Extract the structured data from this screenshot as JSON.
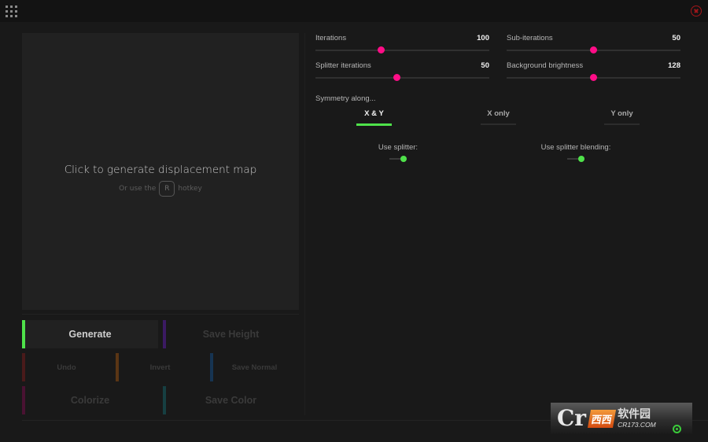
{
  "titlebar": {
    "menu_icon": "apps-grid-icon",
    "close_icon": "close-circle-icon",
    "close_color": "#a3161a"
  },
  "canvas": {
    "title": "Click to generate displacement map",
    "hint_prefix": "Or use the",
    "hotkey": "R",
    "hint_suffix": "hotkey"
  },
  "buttons": {
    "generate": {
      "label": "Generate",
      "accent": "#4fe24a",
      "enabled": true
    },
    "save_height": {
      "label": "Save Height",
      "accent": "#3b1a63",
      "enabled": false
    },
    "undo": {
      "label": "Undo",
      "accent": "#4a1a1a",
      "enabled": false
    },
    "invert": {
      "label": "Invert",
      "accent": "#5a3514",
      "enabled": false
    },
    "save_normal": {
      "label": "Save Normal",
      "accent": "#163452",
      "enabled": false
    },
    "colorize": {
      "label": "Colorize",
      "accent": "#4a1232",
      "enabled": false
    },
    "save_color": {
      "label": "Save Color",
      "accent": "#163f42",
      "enabled": false
    }
  },
  "sliders": [
    {
      "label": "Iterations",
      "value": "100",
      "fraction": 0.38
    },
    {
      "label": "Sub-iterations",
      "value": "50",
      "fraction": 0.5
    },
    {
      "label": "Splitter iterations",
      "value": "50",
      "fraction": 0.47
    },
    {
      "label": "Background brightness",
      "value": "128",
      "fraction": 0.5
    }
  ],
  "slider_accent": "#ff0d87",
  "symmetry": {
    "label": "Symmetry along...",
    "options": [
      {
        "label": "X & Y",
        "selected": true
      },
      {
        "label": "X only",
        "selected": false
      },
      {
        "label": "Y only",
        "selected": false
      }
    ],
    "accent": "#4fe24a"
  },
  "toggles": [
    {
      "label": "Use splitter:",
      "on": true
    },
    {
      "label": "Use splitter blending:",
      "on": true
    }
  ],
  "watermark": {
    "logo": "Cr",
    "boxes": [
      "西西",
      ""
    ],
    "chinese": "软件园",
    "url": "CR173.COM"
  }
}
